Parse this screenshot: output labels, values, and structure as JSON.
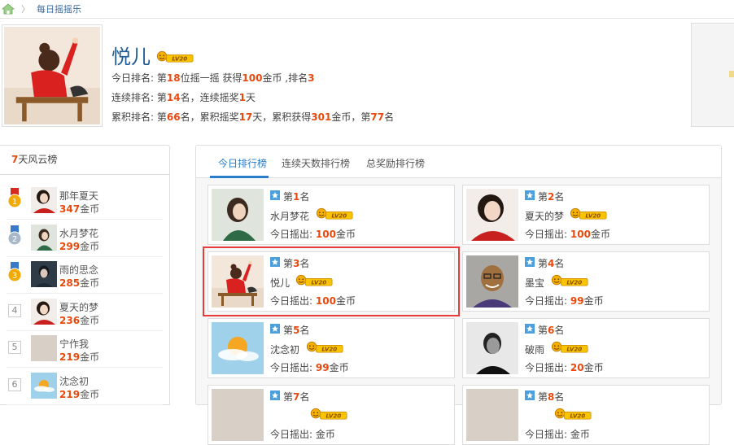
{
  "breadcrumb": {
    "current": "每日摇摇乐"
  },
  "profile": {
    "name": "悦儿",
    "level_badge": "LV20",
    "today": {
      "p1": "今日排名: 第",
      "pos": "18",
      "p2": "位摇一摇 获得",
      "coins": "100",
      "p3": "金币 ,排名",
      "rank": "3"
    },
    "streak": {
      "p1": "连续排名: 第",
      "rank": "14",
      "p2": "名，连续摇奖",
      "days": "1",
      "p3": "天"
    },
    "total": {
      "p1": "累积排名: 第",
      "rank": "66",
      "p2": "名，累积摇奖",
      "days": "17",
      "p3": "天，累积获得",
      "coins": "301",
      "p4": "金币，第",
      "rank2": "77",
      "p5": "名"
    }
  },
  "week": {
    "title_num": "7",
    "title_text": "天风云榜",
    "coin_unit": "金币",
    "items": [
      {
        "rank": "1",
        "name": "那年夏天",
        "coins": "347"
      },
      {
        "rank": "2",
        "name": "水月梦花",
        "coins": "299"
      },
      {
        "rank": "3",
        "name": "雨的思念",
        "coins": "285"
      },
      {
        "rank": "4",
        "name": "夏天的梦",
        "coins": "236"
      },
      {
        "rank": "5",
        "name": "宁作我",
        "coins": "219"
      },
      {
        "rank": "6",
        "name": "沈念初",
        "coins": "219"
      }
    ]
  },
  "tabs": [
    "今日排行榜",
    "连续天数排行榜",
    "总奖励排行榜"
  ],
  "today_board": {
    "rank_prefix": "第",
    "rank_suffix": "名",
    "shake_label": "今日摇出:",
    "coin_unit": "金币",
    "level_badge": "LV20",
    "cards": [
      {
        "rank": "1",
        "name": "水月梦花",
        "coins": "100"
      },
      {
        "rank": "2",
        "name": "夏天的梦",
        "coins": "100"
      },
      {
        "rank": "3",
        "name": "悦儿",
        "coins": "100"
      },
      {
        "rank": "4",
        "name": "墨宝",
        "coins": "99"
      },
      {
        "rank": "5",
        "name": "沈念初",
        "coins": "99"
      },
      {
        "rank": "6",
        "name": "破雨",
        "coins": "20"
      },
      {
        "rank": "7",
        "name": "",
        "coins": ""
      },
      {
        "rank": "8",
        "name": "",
        "coins": ""
      }
    ]
  },
  "colors": {
    "accent": "#2a7dc8",
    "highlight": "#e8490e",
    "name_blue": "#1e5a96",
    "box_red": "#e83b3b"
  }
}
